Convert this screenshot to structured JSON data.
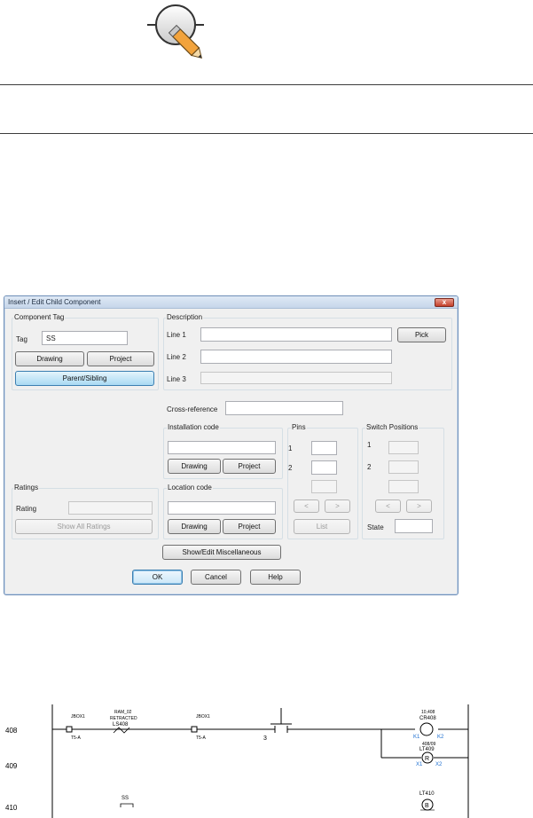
{
  "dialog": {
    "title": "Insert / Edit Child Component",
    "close_label": "x",
    "component_tag": {
      "group_label": "Component Tag",
      "tag_label": "Tag",
      "tag_value": "SS",
      "drawing_label": "Drawing",
      "project_label": "Project",
      "parent_sibling_label": "Parent/Sibling"
    },
    "description": {
      "group_label": "Description",
      "line1_label": "Line 1",
      "line2_label": "Line 2",
      "line3_label": "Line 3",
      "line1_value": "",
      "line2_value": "",
      "line3_value": "",
      "pick_label": "Pick"
    },
    "cross_reference": {
      "label": "Cross-reference",
      "value": ""
    },
    "installation_code": {
      "group_label": "Installation code",
      "value": "",
      "drawing_label": "Drawing",
      "project_label": "Project"
    },
    "location_code": {
      "group_label": "Location code",
      "value": "",
      "drawing_label": "Drawing",
      "project_label": "Project"
    },
    "ratings": {
      "group_label": "Ratings",
      "rating_label": "Rating",
      "rating_value": "",
      "show_all_label": "Show All Ratings"
    },
    "pins": {
      "group_label": "Pins",
      "pin1_label": "1",
      "pin2_label": "2",
      "prev_label": "<",
      "next_label": ">",
      "list_label": "List"
    },
    "switch_positions": {
      "group_label": "Switch Positions",
      "pos1_label": "1",
      "pos2_label": "2",
      "prev_label": "<",
      "next_label": ">",
      "state_label": "State"
    },
    "misc_label": "Show/Edit Miscellaneous",
    "ok_label": "OK",
    "cancel_label": "Cancel",
    "help_label": "Help"
  },
  "schematic": {
    "rungs": [
      "408",
      "409",
      "410"
    ],
    "wire_labels": [
      "JBOX1",
      "JBOX1"
    ],
    "terminal_labels": [
      "T5-A",
      "T5-A"
    ],
    "limit_switch": {
      "line1": "RAM_02",
      "line2": "RETRACTED",
      "tag": "LS408"
    },
    "contact_number": "3",
    "coil": {
      "ref": "10,408",
      "tag": "CR408",
      "pins": [
        "K1",
        "K2"
      ]
    },
    "lamp409": {
      "ref": "408/09",
      "tag": "LT409",
      "pins": [
        "X1",
        "X2"
      ],
      "letter": "R"
    },
    "selector_tag": "SS",
    "lamp410": {
      "tag": "LT410",
      "letter": "B"
    }
  },
  "colors": {
    "schematic_blue": "#1e6fd0",
    "pencil_orange": "#f2a33c"
  }
}
